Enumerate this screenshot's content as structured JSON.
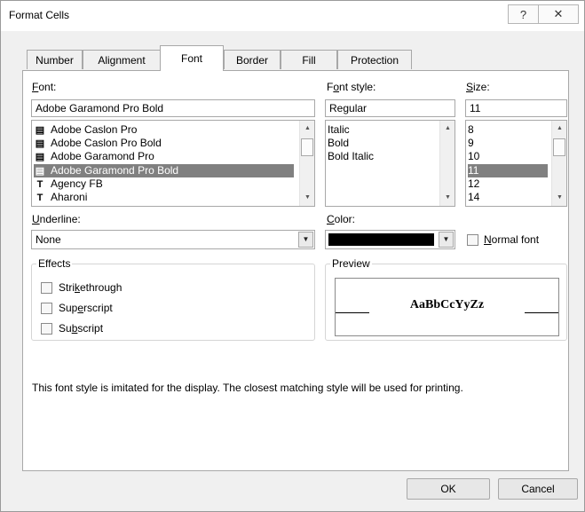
{
  "window": {
    "title": "Format Cells",
    "help_glyph": "?",
    "close_glyph": "✕"
  },
  "tabs": [
    "Number",
    "Alignment",
    "Font",
    "Border",
    "Fill",
    "Protection"
  ],
  "active_tab": "Font",
  "font": {
    "label": "Font:",
    "value": "Adobe Garamond Pro Bold",
    "items": [
      {
        "name": "Adobe Caslon Pro",
        "icon": "printer-font-icon"
      },
      {
        "name": "Adobe Caslon Pro Bold",
        "icon": "printer-font-icon"
      },
      {
        "name": "Adobe Garamond Pro",
        "icon": "printer-font-icon"
      },
      {
        "name": "Adobe Garamond Pro Bold",
        "icon": "printer-font-icon",
        "selected": true
      },
      {
        "name": "Agency FB",
        "icon": "truetype-font-icon"
      },
      {
        "name": "Aharoni",
        "icon": "truetype-font-icon"
      }
    ]
  },
  "font_style": {
    "label": "Font style:",
    "value": "Regular",
    "items": [
      "Italic",
      "Bold",
      "Bold Italic"
    ]
  },
  "size": {
    "label": "Size:",
    "value": "11",
    "items": [
      "8",
      "9",
      "10",
      "11",
      "12",
      "14"
    ],
    "selected": "11"
  },
  "underline": {
    "label": "Underline:",
    "value": "None"
  },
  "color": {
    "label": "Color:",
    "value": "#000000"
  },
  "normal_font": {
    "label": "Normal font",
    "checked": false
  },
  "effects": {
    "title": "Effects",
    "strikethrough": "Strikethrough",
    "superscript": "Superscript",
    "subscript": "Subscript"
  },
  "preview": {
    "title": "Preview",
    "sample": "AaBbCcYyZz"
  },
  "info_text": "This font style is imitated for the display.  The closest matching style will be used for printing.",
  "buttons": {
    "ok": "OK",
    "cancel": "Cancel"
  }
}
